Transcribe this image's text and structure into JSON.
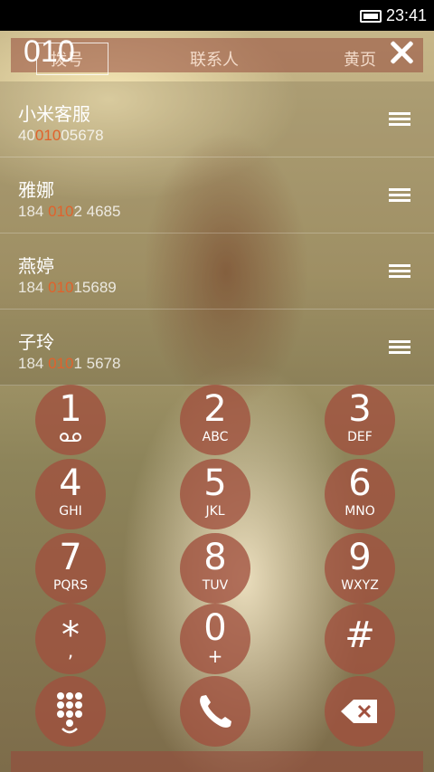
{
  "status_bar": {
    "time": "23:41",
    "battery_icon": "battery-icon"
  },
  "header": {
    "tabs": [
      "拨号",
      "联系人",
      "黄页"
    ],
    "dialed_number": "010",
    "close_icon": "close-icon"
  },
  "contacts": [
    {
      "name": "小米客服",
      "number_before": "40",
      "number_match": "010",
      "number_after": "05678"
    },
    {
      "name": "雅娜",
      "number_before": "184 ",
      "number_match": "010",
      "number_after": "2 4685"
    },
    {
      "name": "燕婷",
      "number_before": "184 ",
      "number_match": "010",
      "number_after": "15689"
    },
    {
      "name": "子玲",
      "number_before": "184 ",
      "number_match": "010",
      "number_after": "1 5678"
    }
  ],
  "keypad": {
    "keys": [
      {
        "digit": "1",
        "letters": ""
      },
      {
        "digit": "2",
        "letters": "ABC"
      },
      {
        "digit": "3",
        "letters": "DEF"
      },
      {
        "digit": "4",
        "letters": "GHI"
      },
      {
        "digit": "5",
        "letters": "JKL"
      },
      {
        "digit": "6",
        "letters": "MNO"
      },
      {
        "digit": "7",
        "letters": "PQRS"
      },
      {
        "digit": "8",
        "letters": "TUV"
      },
      {
        "digit": "9",
        "letters": "WXYZ"
      },
      {
        "digit": "*",
        "letters": ","
      },
      {
        "digit": "0",
        "letters": "+"
      },
      {
        "digit": "#",
        "letters": ""
      }
    ],
    "bottom_actions": [
      "dialpad-toggle-icon",
      "phone-icon",
      "backspace-icon"
    ]
  },
  "colors": {
    "highlight": "#e0622c",
    "key_bg": "#a0503e",
    "header_bg": "#964b3c"
  }
}
